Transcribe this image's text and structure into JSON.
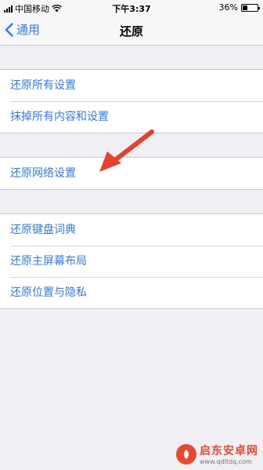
{
  "status_bar": {
    "carrier": "中国移动",
    "time": "下午3:37",
    "battery_text": "36%",
    "battery_level": 0.36
  },
  "nav": {
    "back_label": "通用",
    "title": "还原"
  },
  "groups": [
    {
      "items": [
        "还原所有设置",
        "抹掉所有内容和设置"
      ]
    },
    {
      "items": [
        "还原网络设置"
      ]
    },
    {
      "items": [
        "还原键盘词典",
        "还原主屏幕布局",
        "还原位置与隐私"
      ]
    }
  ],
  "colors": {
    "accent": "#2f7cf6",
    "background": "#efeff4",
    "annotation_arrow": "#e8402b"
  },
  "annotation": {
    "type": "arrow",
    "points_to": "还原网络设置"
  },
  "watermark": {
    "title": "启东安卓网",
    "url": "www.qdltdq.com"
  }
}
